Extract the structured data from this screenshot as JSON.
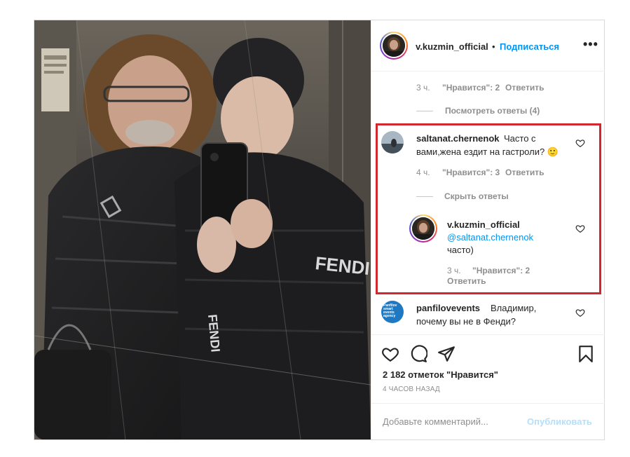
{
  "header": {
    "username": "v.kuzmin_official",
    "separator": "•",
    "follow_label": "Подписаться",
    "more_icon": "more-horizontal-icon"
  },
  "comments": {
    "top_meta": {
      "time": "3 ч.",
      "likes": "\"Нравится\": 2",
      "reply": "Ответить"
    },
    "view_replies": "Посмотреть ответы (4)",
    "c1": {
      "username": "saltanat.chernenok",
      "text_line1": "Часто с",
      "text_line2": "вами,жена ездит на гастроли? 🙂",
      "time": "4 ч.",
      "likes": "\"Нравится\": 3",
      "reply": "Ответить",
      "hide_replies": "Скрыть ответы"
    },
    "r1": {
      "username": "v.kuzmin_official",
      "mention": "@saltanat.chernenok",
      "text": "часто)",
      "time": "3 ч.",
      "likes": "\"Нравится\": 2",
      "reply": "Ответить"
    },
    "c2": {
      "username": "panfilovevents",
      "text_line1": "Владимир,",
      "text_line2": "почему вы не в Фенди?",
      "avatar_text": "Panfilov smart events agency"
    }
  },
  "post": {
    "likes_count": "2 182 отметок \"Нравится\"",
    "posted_ago": "4 ЧАСОВ НАЗАД",
    "comment_placeholder": "Добавьте комментарий...",
    "publish_label": "Опубликовать"
  },
  "colors": {
    "accent": "#0095f6",
    "highlight_border": "#d0282e",
    "muted": "#8e8e8e",
    "text": "#262626"
  }
}
